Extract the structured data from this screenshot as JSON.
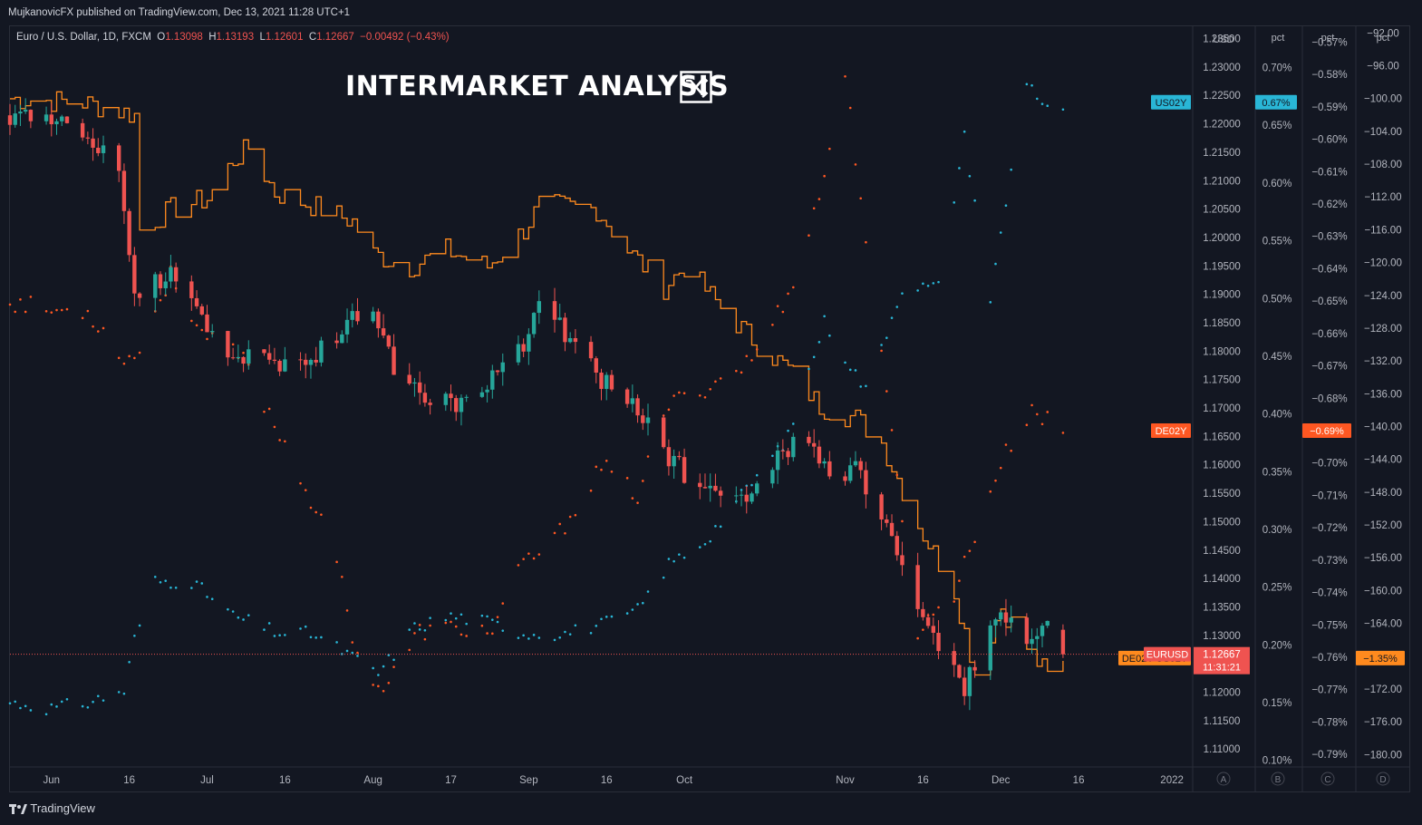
{
  "topbar": {
    "text": "MujkanovicFX published on TradingView.com, Dec 13, 2021 11:28 UTC+1"
  },
  "legend": {
    "symbol": "Euro / U.S. Dollar, 1D, FXCM",
    "o_label": "O",
    "o": "1.13098",
    "h_label": "H",
    "h": "1.13193",
    "l_label": "L",
    "l": "1.12601",
    "c_label": "C",
    "c": "1.12667",
    "change": "−0.00492 (−0.43%)"
  },
  "headline": "INTERMARKET ANALYSIS",
  "headline_icon": "shuffle-icon",
  "brand": {
    "name": "TradingView",
    "icon": "tradingview-logo-icon"
  },
  "colors": {
    "background": "#131722",
    "up": "#26a69a",
    "down": "#ef5350",
    "us02y": "#29b6d6",
    "de02y": "#ff5722",
    "spread": "#ff8a1e"
  },
  "chart_data": {
    "type": "line",
    "title": "Euro / U.S. Dollar, 1D, FXCM",
    "x": {
      "ticks": [
        "Jun",
        "16",
        "Jul",
        "16",
        "Aug",
        "17",
        "Sep",
        "16",
        "Oct",
        "Nov",
        "16",
        "Dec",
        "16",
        "2022"
      ],
      "range": [
        "2021-05-24",
        "2022-01-07"
      ]
    },
    "axes": [
      {
        "id": "A",
        "unit": "USD",
        "range": [
          1.107,
          1.237
        ],
        "ticks": [
          "1.23500",
          "1.23000",
          "1.22500",
          "1.22000",
          "1.21500",
          "1.21000",
          "1.20500",
          "1.20000",
          "1.19500",
          "1.19000",
          "1.18500",
          "1.18000",
          "1.17500",
          "1.17000",
          "1.16500",
          "1.16000",
          "1.15500",
          "1.15000",
          "1.14500",
          "1.14000",
          "1.13500",
          "1.13000",
          "1.12500",
          "1.12000",
          "1.11500",
          "1.11000"
        ]
      },
      {
        "id": "B",
        "unit": "pct",
        "range": [
          0.095,
          0.735
        ],
        "ticks": [
          "0.70%",
          "0.65%",
          "0.60%",
          "0.55%",
          "0.50%",
          "0.45%",
          "0.40%",
          "0.35%",
          "0.30%",
          "0.25%",
          "0.20%",
          "0.15%",
          "0.10%"
        ]
      },
      {
        "id": "C",
        "unit": "pct",
        "range": [
          -0.7936,
          -0.5654
        ],
        "ticks": [
          "−0.57%",
          "−0.58%",
          "−0.59%",
          "−0.60%",
          "−0.61%",
          "−0.62%",
          "−0.63%",
          "−0.64%",
          "−0.65%",
          "−0.66%",
          "−0.67%",
          "−0.68%",
          "−0.69%",
          "−0.70%",
          "−0.71%",
          "−0.72%",
          "−0.73%",
          "−0.74%",
          "−0.75%",
          "−0.76%",
          "−0.77%",
          "−0.78%",
          "−0.79%"
        ]
      },
      {
        "id": "D",
        "unit": "pct",
        "range": [
          -181.4,
          -91.3
        ],
        "ticks": [
          "−92.00",
          "−96.00",
          "−100.00",
          "−104.00",
          "−108.00",
          "−112.00",
          "−116.00",
          "−120.00",
          "−124.00",
          "−128.00",
          "−132.00",
          "−136.00",
          "−140.00",
          "−144.00",
          "−148.00",
          "−152.00",
          "−156.00",
          "−160.00",
          "−164.00",
          "−168.00",
          "−172.00",
          "−176.00",
          "−180.00"
        ]
      }
    ],
    "series": [
      {
        "name": "EURUSD",
        "type": "candlestick",
        "axis": "A",
        "last": "1.12667",
        "countdown": "11:31:21",
        "close": [
          [
            "2021-05-24",
            1.2215
          ],
          [
            "2021-06-01",
            1.221
          ],
          [
            "2021-06-08",
            1.2175
          ],
          [
            "2021-06-14",
            1.212
          ],
          [
            "2021-06-17",
            1.191
          ],
          [
            "2021-06-25",
            1.1935
          ],
          [
            "2021-06-30",
            1.1855
          ],
          [
            "2021-07-07",
            1.179
          ],
          [
            "2021-07-13",
            1.1775
          ],
          [
            "2021-07-20",
            1.178
          ],
          [
            "2021-07-27",
            1.184
          ],
          [
            "2021-08-02",
            1.1875
          ],
          [
            "2021-08-06",
            1.176
          ],
          [
            "2021-08-11",
            1.1725
          ],
          [
            "2021-08-18",
            1.1705
          ],
          [
            "2021-08-24",
            1.1745
          ],
          [
            "2021-08-31",
            1.181
          ],
          [
            "2021-09-03",
            1.188
          ],
          [
            "2021-09-10",
            1.181
          ],
          [
            "2021-09-17",
            1.1727
          ],
          [
            "2021-09-23",
            1.169
          ],
          [
            "2021-09-28",
            1.161
          ],
          [
            "2021-10-06",
            1.155
          ],
          [
            "2021-10-12",
            1.1528
          ],
          [
            "2021-10-19",
            1.162
          ],
          [
            "2021-10-25",
            1.165
          ],
          [
            "2021-10-29",
            1.157
          ],
          [
            "2021-11-03",
            1.159
          ],
          [
            "2021-11-10",
            1.148
          ],
          [
            "2021-11-16",
            1.132
          ],
          [
            "2021-11-24",
            1.1205
          ],
          [
            "2021-11-30",
            1.134
          ],
          [
            "2021-12-06",
            1.1285
          ],
          [
            "2021-12-10",
            1.1315
          ],
          [
            "2021-12-13",
            1.12667
          ]
        ]
      },
      {
        "name": "US02Y",
        "type": "dots",
        "axis": "B",
        "last": "0.67%",
        "points": [
          [
            "2021-05-24",
            0.15
          ],
          [
            "2021-06-01",
            0.145
          ],
          [
            "2021-06-08",
            0.15
          ],
          [
            "2021-06-15",
            0.16
          ],
          [
            "2021-06-17",
            0.205
          ],
          [
            "2021-06-21",
            0.255
          ],
          [
            "2021-06-28",
            0.255
          ],
          [
            "2021-07-06",
            0.225
          ],
          [
            "2021-07-15",
            0.21
          ],
          [
            "2021-07-21",
            0.21
          ],
          [
            "2021-07-27",
            0.195
          ],
          [
            "2021-08-03",
            0.175
          ],
          [
            "2021-08-10",
            0.215
          ],
          [
            "2021-08-17",
            0.225
          ],
          [
            "2021-08-24",
            0.22
          ],
          [
            "2021-08-31",
            0.21
          ],
          [
            "2021-09-08",
            0.21
          ],
          [
            "2021-09-17",
            0.22
          ],
          [
            "2021-09-22",
            0.23
          ],
          [
            "2021-09-28",
            0.27
          ],
          [
            "2021-10-05",
            0.29
          ],
          [
            "2021-10-14",
            0.34
          ],
          [
            "2021-10-21",
            0.38
          ],
          [
            "2021-10-28",
            0.48
          ],
          [
            "2021-11-05",
            0.42
          ],
          [
            "2021-11-12",
            0.51
          ],
          [
            "2021-11-19",
            0.51
          ],
          [
            "2021-11-24",
            0.64
          ],
          [
            "2021-11-29",
            0.5
          ],
          [
            "2021-12-03",
            0.61
          ],
          [
            "2021-12-06",
            0.69
          ],
          [
            "2021-12-09",
            0.67
          ],
          [
            "2021-12-13",
            0.66
          ]
        ]
      },
      {
        "name": "DE02Y",
        "type": "dots",
        "axis": "C",
        "last": "−0.69%",
        "points": [
          [
            "2021-05-24",
            -0.65
          ],
          [
            "2021-06-01",
            -0.653
          ],
          [
            "2021-06-08",
            -0.653
          ],
          [
            "2021-06-14",
            -0.666
          ],
          [
            "2021-06-17",
            -0.668
          ],
          [
            "2021-06-24",
            -0.642
          ],
          [
            "2021-07-01",
            -0.662
          ],
          [
            "2021-07-08",
            -0.668
          ],
          [
            "2021-07-14",
            -0.688
          ],
          [
            "2021-07-19",
            -0.704
          ],
          [
            "2021-07-26",
            -0.73
          ],
          [
            "2021-07-30",
            -0.76
          ],
          [
            "2021-08-04",
            -0.77
          ],
          [
            "2021-08-11",
            -0.752
          ],
          [
            "2021-08-18",
            -0.751
          ],
          [
            "2021-08-25",
            -0.752
          ],
          [
            "2021-08-31",
            -0.731
          ],
          [
            "2021-09-06",
            -0.724
          ],
          [
            "2021-09-15",
            -0.701
          ],
          [
            "2021-09-22",
            -0.71
          ],
          [
            "2021-09-28",
            -0.682
          ],
          [
            "2021-10-06",
            -0.676
          ],
          [
            "2021-10-14",
            -0.668
          ],
          [
            "2021-10-21",
            -0.648
          ],
          [
            "2021-10-27",
            -0.618
          ],
          [
            "2021-11-01",
            -0.58
          ],
          [
            "2021-11-08",
            -0.668
          ],
          [
            "2021-11-15",
            -0.752
          ],
          [
            "2021-11-22",
            -0.74
          ],
          [
            "2021-12-01",
            -0.7
          ],
          [
            "2021-12-07",
            -0.683
          ],
          [
            "2021-12-10",
            -0.687
          ],
          [
            "2021-12-13",
            -0.69
          ]
        ]
      },
      {
        "name": "DE02Y-US02Y",
        "type": "step",
        "axis": "D",
        "last": "−1.35%",
        "points": [
          [
            "2021-05-24",
            -100.0
          ],
          [
            "2021-06-07",
            -100.5
          ],
          [
            "2021-06-17",
            -102.0
          ],
          [
            "2021-06-18",
            -116.0
          ],
          [
            "2021-06-24",
            -113.5
          ],
          [
            "2021-07-01",
            -112.2
          ],
          [
            "2021-07-06",
            -107.5
          ],
          [
            "2021-07-09",
            -106.0
          ],
          [
            "2021-07-14",
            -111.5
          ],
          [
            "2021-07-21",
            -113.0
          ],
          [
            "2021-07-29",
            -115.0
          ],
          [
            "2021-08-02",
            -119.0
          ],
          [
            "2021-08-09",
            -120.5
          ],
          [
            "2021-08-16",
            -118.5
          ],
          [
            "2021-08-24",
            -120.5
          ],
          [
            "2021-08-31",
            -116.0
          ],
          [
            "2021-09-03",
            -113.0
          ],
          [
            "2021-09-14",
            -113.5
          ],
          [
            "2021-09-20",
            -118.5
          ],
          [
            "2021-09-27",
            -123.0
          ],
          [
            "2021-10-01",
            -120.5
          ],
          [
            "2021-10-08",
            -125.5
          ],
          [
            "2021-10-15",
            -130.0
          ],
          [
            "2021-10-21",
            -133.0
          ],
          [
            "2021-10-27",
            -137.5
          ],
          [
            "2021-11-03",
            -139.0
          ],
          [
            "2021-11-08",
            -142.0
          ],
          [
            "2021-11-15",
            -152.0
          ],
          [
            "2021-11-22",
            -160.0
          ],
          [
            "2021-11-26",
            -170.0
          ],
          [
            "2021-12-01",
            -162.0
          ],
          [
            "2021-12-06",
            -167.0
          ],
          [
            "2021-12-10",
            -170.5
          ],
          [
            "2021-12-13",
            -169.0
          ]
        ]
      }
    ],
    "tags": {
      "us02y": "US02Y",
      "de02y": "DE02Y",
      "spread": "DE02Y-US02Y",
      "eurusd": "EURUSD"
    },
    "scale_letters": [
      "A",
      "B",
      "C",
      "D"
    ]
  }
}
